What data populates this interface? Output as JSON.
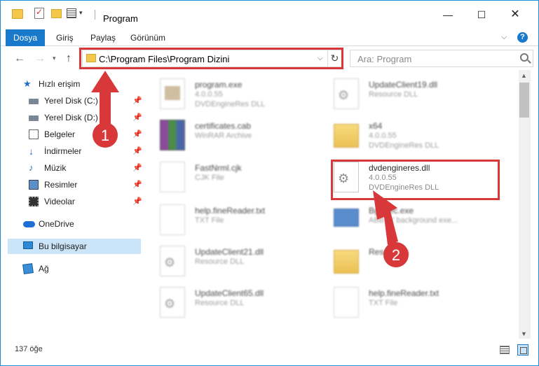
{
  "window": {
    "title": "Program"
  },
  "ribbon": {
    "tabs": [
      {
        "label": "Dosya"
      },
      {
        "label": "Giriş"
      },
      {
        "label": "Paylaş"
      },
      {
        "label": "Görünüm"
      }
    ],
    "help": "?"
  },
  "address": {
    "path": "C:\\Program Files\\Program Dizini",
    "search_placeholder": "Ara: Program"
  },
  "sidebar": {
    "items": [
      {
        "label": "Hızlı erişim",
        "icon": "star-icon"
      },
      {
        "label": "Yerel Disk (C:)",
        "icon": "drive-icon",
        "pinned": true
      },
      {
        "label": "Yerel Disk (D:)",
        "icon": "drive-icon",
        "pinned": true
      },
      {
        "label": "Belgeler",
        "icon": "documents-icon",
        "pinned": true
      },
      {
        "label": "İndirmeler",
        "icon": "downloads-icon",
        "pinned": true
      },
      {
        "label": "Müzik",
        "icon": "music-icon",
        "pinned": true
      },
      {
        "label": "Resimler",
        "icon": "pictures-icon",
        "pinned": true
      },
      {
        "label": "Videolar",
        "icon": "videos-icon",
        "pinned": true
      },
      {
        "label": "OneDrive",
        "icon": "cloud-icon"
      },
      {
        "label": "Bu bilgisayar",
        "icon": "computer-icon",
        "selected": true
      },
      {
        "label": "Ağ",
        "icon": "network-icon"
      }
    ]
  },
  "files": [
    {
      "name": "program.exe",
      "line1": "4.0.0.55",
      "line2": "DVDEngineRes DLL",
      "icon": "exe-icon"
    },
    {
      "name": "UpdateClient19.dll",
      "line1": "Resource DLL",
      "line2": "",
      "icon": "dll-icon"
    },
    {
      "name": "certificates.cab",
      "line1": "WinRAR Archive",
      "line2": "",
      "icon": "archive-icon"
    },
    {
      "name": "x64",
      "line1": "4.0.0.55",
      "line2": "DVDEngineRes DLL",
      "icon": "folder-icon"
    },
    {
      "name": "FastNrml.cjk",
      "line1": "CJK File",
      "line2": "",
      "icon": "file-icon"
    },
    {
      "name": "dvdengineres.dll",
      "line1": "4.0.0.55",
      "line2": "DVDEngineRes DLL",
      "icon": "dll-icon"
    },
    {
      "name": "help.fineReader.txt",
      "line1": "TXT File",
      "line2": "",
      "icon": "text-file-icon"
    },
    {
      "name": "BgExec.exe",
      "line1": "ABBYY background exe...",
      "line2": "",
      "icon": "bg-exe-icon"
    },
    {
      "name": "UpdateClient21.dll",
      "line1": "Resource DLL",
      "line2": "",
      "icon": "dll-icon"
    },
    {
      "name": "Resources",
      "line1": "",
      "line2": "",
      "icon": "folder-icon"
    },
    {
      "name": "UpdateClient65.dll",
      "line1": "Resource DLL",
      "line2": "",
      "icon": "dll-icon"
    },
    {
      "name": "help.fineReader.txt",
      "line1": "TXT File",
      "line2": "",
      "icon": "text-file-icon"
    }
  ],
  "status": {
    "count": "137 öğe"
  },
  "annotations": [
    {
      "label": "1"
    },
    {
      "label": "2"
    }
  ],
  "colors": {
    "accent": "#1979ca",
    "highlight": "#d9383a",
    "selected": "#cce4f7"
  }
}
